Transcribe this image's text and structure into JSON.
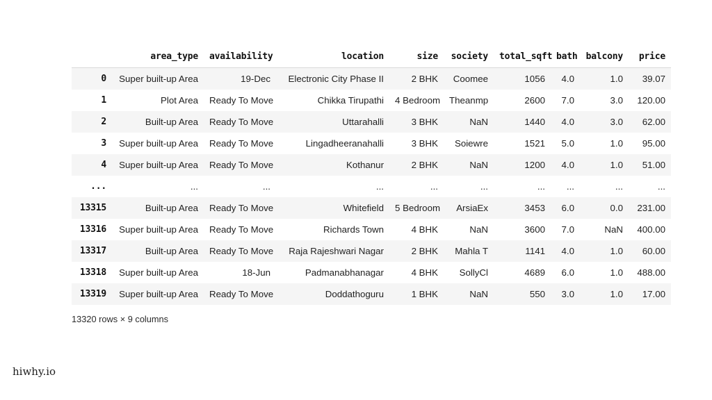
{
  "watermark": "hiwhy.io",
  "table": {
    "index_header": "",
    "columns": [
      "area_type",
      "availability",
      "location",
      "size",
      "society",
      "total_sqft",
      "bath",
      "balcony",
      "price"
    ],
    "rows": [
      {
        "index": "0",
        "cells": [
          "Super built-up Area",
          "19-Dec",
          "Electronic City Phase II",
          "2 BHK",
          "Coomee",
          "1056",
          "4.0",
          "1.0",
          "39.07"
        ]
      },
      {
        "index": "1",
        "cells": [
          "Plot Area",
          "Ready To Move",
          "Chikka Tirupathi",
          "4 Bedroom",
          "Theanmp",
          "2600",
          "7.0",
          "3.0",
          "120.00"
        ]
      },
      {
        "index": "2",
        "cells": [
          "Built-up Area",
          "Ready To Move",
          "Uttarahalli",
          "3 BHK",
          "NaN",
          "1440",
          "4.0",
          "3.0",
          "62.00"
        ]
      },
      {
        "index": "3",
        "cells": [
          "Super built-up Area",
          "Ready To Move",
          "Lingadheeranahalli",
          "3 BHK",
          "Soiewre",
          "1521",
          "5.0",
          "1.0",
          "95.00"
        ]
      },
      {
        "index": "4",
        "cells": [
          "Super built-up Area",
          "Ready To Move",
          "Kothanur",
          "2 BHK",
          "NaN",
          "1200",
          "4.0",
          "1.0",
          "51.00"
        ]
      },
      {
        "index": "...",
        "cells": [
          "...",
          "...",
          "...",
          "...",
          "...",
          "...",
          "...",
          "...",
          "..."
        ],
        "is_ellipsis": true
      },
      {
        "index": "13315",
        "cells": [
          "Built-up Area",
          "Ready To Move",
          "Whitefield",
          "5 Bedroom",
          "ArsiaEx",
          "3453",
          "6.0",
          "0.0",
          "231.00"
        ]
      },
      {
        "index": "13316",
        "cells": [
          "Super built-up Area",
          "Ready To Move",
          "Richards Town",
          "4 BHK",
          "NaN",
          "3600",
          "7.0",
          "NaN",
          "400.00"
        ]
      },
      {
        "index": "13317",
        "cells": [
          "Built-up Area",
          "Ready To Move",
          "Raja Rajeshwari Nagar",
          "2 BHK",
          "Mahla T",
          "1141",
          "4.0",
          "1.0",
          "60.00"
        ]
      },
      {
        "index": "13318",
        "cells": [
          "Super built-up Area",
          "18-Jun",
          "Padmanabhanagar",
          "4 BHK",
          "SollyCl",
          "4689",
          "6.0",
          "1.0",
          "488.00"
        ]
      },
      {
        "index": "13319",
        "cells": [
          "Super built-up Area",
          "Ready To Move",
          "Doddathoguru",
          "1 BHK",
          "NaN",
          "550",
          "3.0",
          "1.0",
          "17.00"
        ]
      }
    ],
    "shape_caption": "13320 rows × 9 columns",
    "stripe_color": "#f5f5f5",
    "header_rule_color": "#d9d9d9"
  }
}
